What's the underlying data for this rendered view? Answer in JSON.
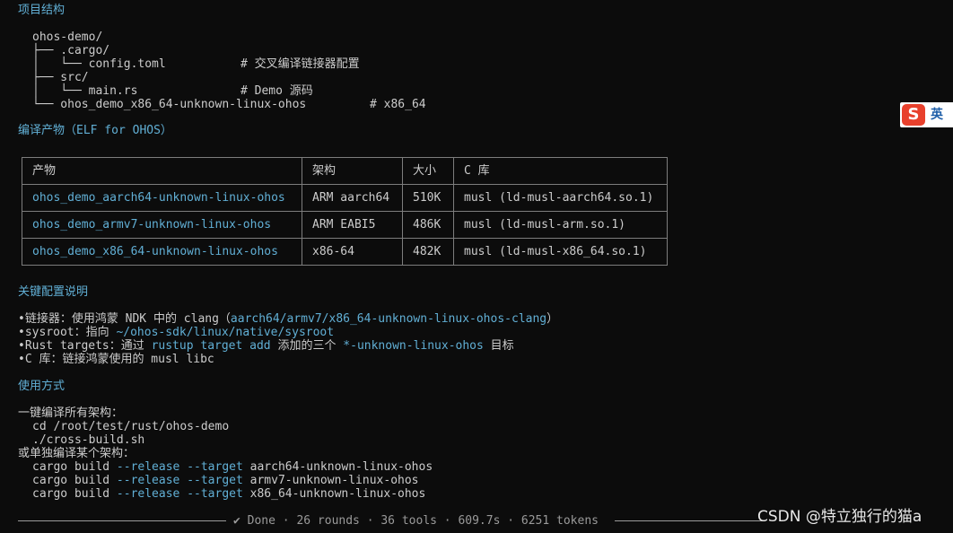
{
  "project": {
    "heading": "项目结构",
    "tree": [
      {
        "text": "ohos-demo/",
        "comment": ""
      },
      {
        "text": "├── .cargo/",
        "comment": ""
      },
      {
        "text": "│   └── config.toml",
        "comment": "# 交叉编译链接器配置"
      },
      {
        "text": "├── src/",
        "comment": ""
      },
      {
        "text": "│   └── main.rs",
        "comment": "# Demo 源码"
      },
      {
        "text": "└── ohos_demo_x86_64-unknown-linux-ohos",
        "comment": "# x86_64"
      }
    ]
  },
  "artifacts": {
    "heading": "编译产物（ELF for OHOS）",
    "columns": [
      "产物",
      "架构",
      "大小",
      "C 库"
    ],
    "rows": [
      [
        "ohos_demo_aarch64-unknown-linux-ohos",
        "ARM aarch64",
        "510K",
        "musl (ld-musl-aarch64.so.1)"
      ],
      [
        "ohos_demo_armv7-unknown-linux-ohos",
        "ARM EABI5",
        "486K",
        "musl (ld-musl-arm.so.1)"
      ],
      [
        "ohos_demo_x86_64-unknown-linux-ohos",
        "x86-64",
        "482K",
        "musl (ld-musl-x86_64.so.1)"
      ]
    ]
  },
  "config": {
    "heading": "关键配置说明",
    "items": [
      {
        "bullet": "•",
        "label": "链接器：使用鸿蒙 NDK 中的 clang（",
        "code": "aarch64/armv7/x86_64-unknown-linux-ohos-clang",
        "tail": "）"
      },
      {
        "bullet": "•",
        "label": "sysroot：指向 ",
        "code": "~/ohos-sdk/linux/native/sysroot",
        "tail": ""
      },
      {
        "bullet": "•",
        "label": "Rust targets：通过 ",
        "code": "rustup target add",
        "mid": " 添加的三个 ",
        "code2": "*-unknown-linux-ohos",
        "tail": " 目标"
      },
      {
        "bullet": "•",
        "label": "C 库：链接鸿蒙使用的 musl libc",
        "code": "",
        "tail": ""
      }
    ]
  },
  "usage": {
    "heading": "使用方式",
    "all_label": "一键编译所有架构：",
    "all_cmds": [
      "cd /root/test/rust/ohos-demo",
      "./cross-build.sh"
    ],
    "single_label": "或单独编译某个架构：",
    "single_cmds": [
      {
        "cmd": "cargo build",
        "flag1": "--release",
        "flag2": "--target",
        "target": "aarch64-unknown-linux-ohos"
      },
      {
        "cmd": "cargo build",
        "flag1": "--release",
        "flag2": "--target",
        "target": "armv7-unknown-linux-ohos"
      },
      {
        "cmd": "cargo build",
        "flag1": "--release",
        "flag2": "--target",
        "target": "x86_64-unknown-linux-ohos"
      }
    ]
  },
  "status": {
    "text": "✔ Done · 26 rounds · 36 tools · 609.7s · 6251 tokens"
  },
  "ime": {
    "icon": "S",
    "lang": "英"
  },
  "watermark": "CSDN @特立独行的猫a",
  "colors": {
    "background": "#0c0c0c",
    "accent": "#61afd5",
    "text": "#cccccc",
    "border": "#7d7d7d"
  }
}
